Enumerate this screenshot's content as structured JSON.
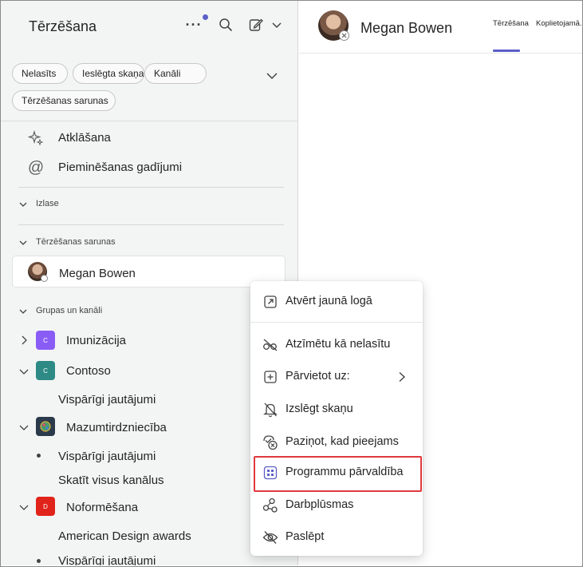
{
  "sidebar": {
    "title": "Tērzēšana",
    "filters": [
      "Nelasīts",
      "Ieslēgta skaņa",
      "Kanāli",
      "Tērzēšanas sarunas"
    ],
    "nav": [
      {
        "label": "Atklāšana",
        "icon": "sparkle-icon"
      },
      {
        "label": "Pieminēšanas gadījumi",
        "icon": "mention-icon"
      }
    ],
    "sections": {
      "favorites": "Izlase",
      "chats": "Tērzēšanas sarunas",
      "teams": "Grupas un kanāli"
    },
    "chat": {
      "name": "Megan Bowen"
    },
    "teams": [
      {
        "name": "Imunizācija",
        "initial": "C",
        "color": "#8a5cf6"
      },
      {
        "name": "Contoso",
        "initial": "C",
        "color": "#2d8a85"
      },
      {
        "name": "Mazumtirdzniecība",
        "initial": "",
        "color": "#2b3a4a"
      },
      {
        "name": "Noformēšana",
        "initial": "D",
        "color": "#e0241b"
      }
    ],
    "channels": {
      "contoso_general": "Vispārīgi jautājumi",
      "retail_general": "Vispārīgi jautājumi",
      "retail_all": "Skatīt visus kanālus",
      "design_awards": "American Design awards",
      "design_general": "Vispārīgi jautājumi"
    }
  },
  "conversation": {
    "name": "Megan Bowen",
    "tabs": [
      "Tērzēšana",
      "Koplietojamā."
    ]
  },
  "context_menu": {
    "items": [
      {
        "label": "Atvērt jaunā logā",
        "icon": "open-in-new-window-icon"
      },
      {
        "label": "Atzīmētu kā nelasītu",
        "icon": "mark-unread-icon"
      },
      {
        "label": "Pārvietot uz:",
        "icon": "move-to-icon"
      },
      {
        "label": "Izslēgt skaņu",
        "icon": "mute-bell-icon"
      },
      {
        "label": "Paziņot, kad pieejams",
        "icon": "notify-available-icon"
      },
      {
        "label": "Programmu pārvaldība",
        "icon": "apps-grid-icon"
      },
      {
        "label": "Darbplūsmas",
        "icon": "workflows-icon"
      },
      {
        "label": "Paslēpt",
        "icon": "hide-eye-icon"
      }
    ],
    "highlighted": "Programmu pārvaldība"
  },
  "colors": {
    "accent": "#5b5fc7",
    "highlight": "#e0393e",
    "sidebar_bg": "#f3f5f5"
  }
}
